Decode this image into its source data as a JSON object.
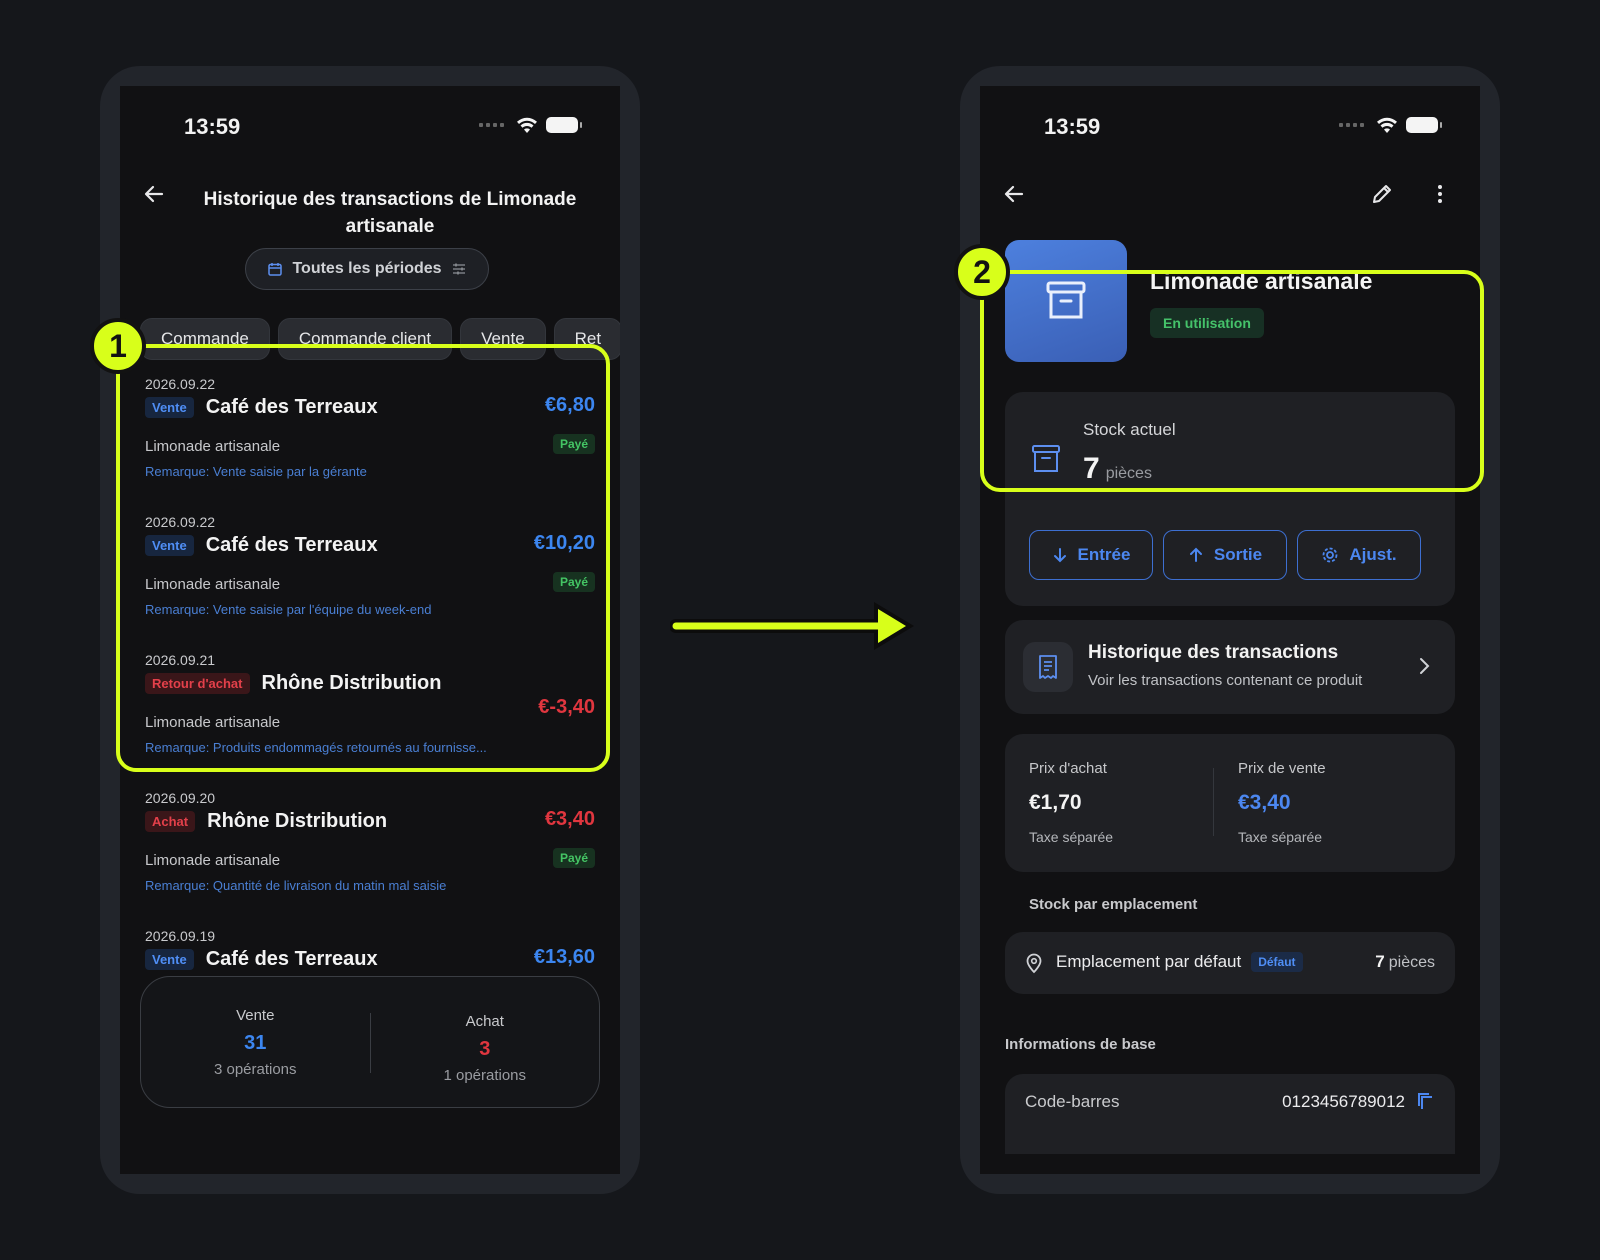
{
  "left_screen": {
    "status_time": "13:59",
    "title": "Historique des transactions de Limonade artisanale",
    "period_filter": "Toutes les périodes",
    "filter_chips": [
      "Commande",
      "Commande client",
      "Vente",
      "Ret"
    ],
    "transactions": [
      {
        "date": "2026.09.22",
        "type": "Vente",
        "type_color": "blue",
        "party": "Café des Terreaux",
        "product": "Limonade artisanale",
        "note": "Remarque: Vente saisie par la gérante",
        "amount": "€6,80",
        "amount_color": "blue",
        "status": "Payé"
      },
      {
        "date": "2026.09.22",
        "type": "Vente",
        "type_color": "blue",
        "party": "Café des Terreaux",
        "product": "Limonade artisanale",
        "note": "Remarque: Vente saisie par l'équipe du week-end",
        "amount": "€10,20",
        "amount_color": "blue",
        "status": "Payé"
      },
      {
        "date": "2026.09.21",
        "type": "Retour d'achat",
        "type_color": "red",
        "party": "Rhône Distribution",
        "product": "Limonade artisanale",
        "note": "Remarque: Produits endommagés retournés au fournisse...",
        "amount": "€-3,40",
        "amount_color": "red",
        "status": ""
      },
      {
        "date": "2026.09.20",
        "type": "Achat",
        "type_color": "red",
        "party": "Rhône Distribution",
        "product": "Limonade artisanale",
        "note": "Remarque: Quantité de livraison du matin mal saisie",
        "amount": "€3,40",
        "amount_color": "red",
        "status": "Payé"
      },
      {
        "date": "2026.09.19",
        "type": "Vente",
        "type_color": "blue",
        "party": "Café des Terreaux",
        "product": "",
        "note": "",
        "amount": "€13,60",
        "amount_color": "blue",
        "status": ""
      }
    ],
    "summary": {
      "sale_label": "Vente",
      "sale_value": "31",
      "sale_ops": "3 opérations",
      "purchase_label": "Achat",
      "purchase_value": "3",
      "purchase_ops": "1 opérations"
    }
  },
  "right_screen": {
    "status_time": "13:59",
    "product_name": "Limonade artisanale",
    "state": "En utilisation",
    "stock_label": "Stock actuel",
    "stock_value": "7",
    "stock_unit": "pièces",
    "actions": [
      "Entrée",
      "Sortie",
      "Ajust."
    ],
    "history_title": "Historique des transactions",
    "history_subtitle": "Voir les transactions contenant ce produit",
    "purchase_price_label": "Prix d'achat",
    "purchase_price": "€1,70",
    "purchase_tax": "Taxe séparée",
    "sale_price_label": "Prix de vente",
    "sale_price": "€3,40",
    "sale_tax": "Taxe séparée",
    "location_section": "Stock par emplacement",
    "location_name": "Emplacement par défaut",
    "location_badge": "Défaut",
    "location_qty": "7",
    "location_unit": "pièces",
    "info_section": "Informations de base",
    "barcode_label": "Code-barres",
    "barcode_value": "0123456789012"
  },
  "callouts": [
    "1",
    "2"
  ],
  "colors": {
    "highlight": "#d8ff1a",
    "accent_blue": "#3c86f0",
    "accent_red": "#e0363f",
    "paid_green": "#44c564"
  }
}
